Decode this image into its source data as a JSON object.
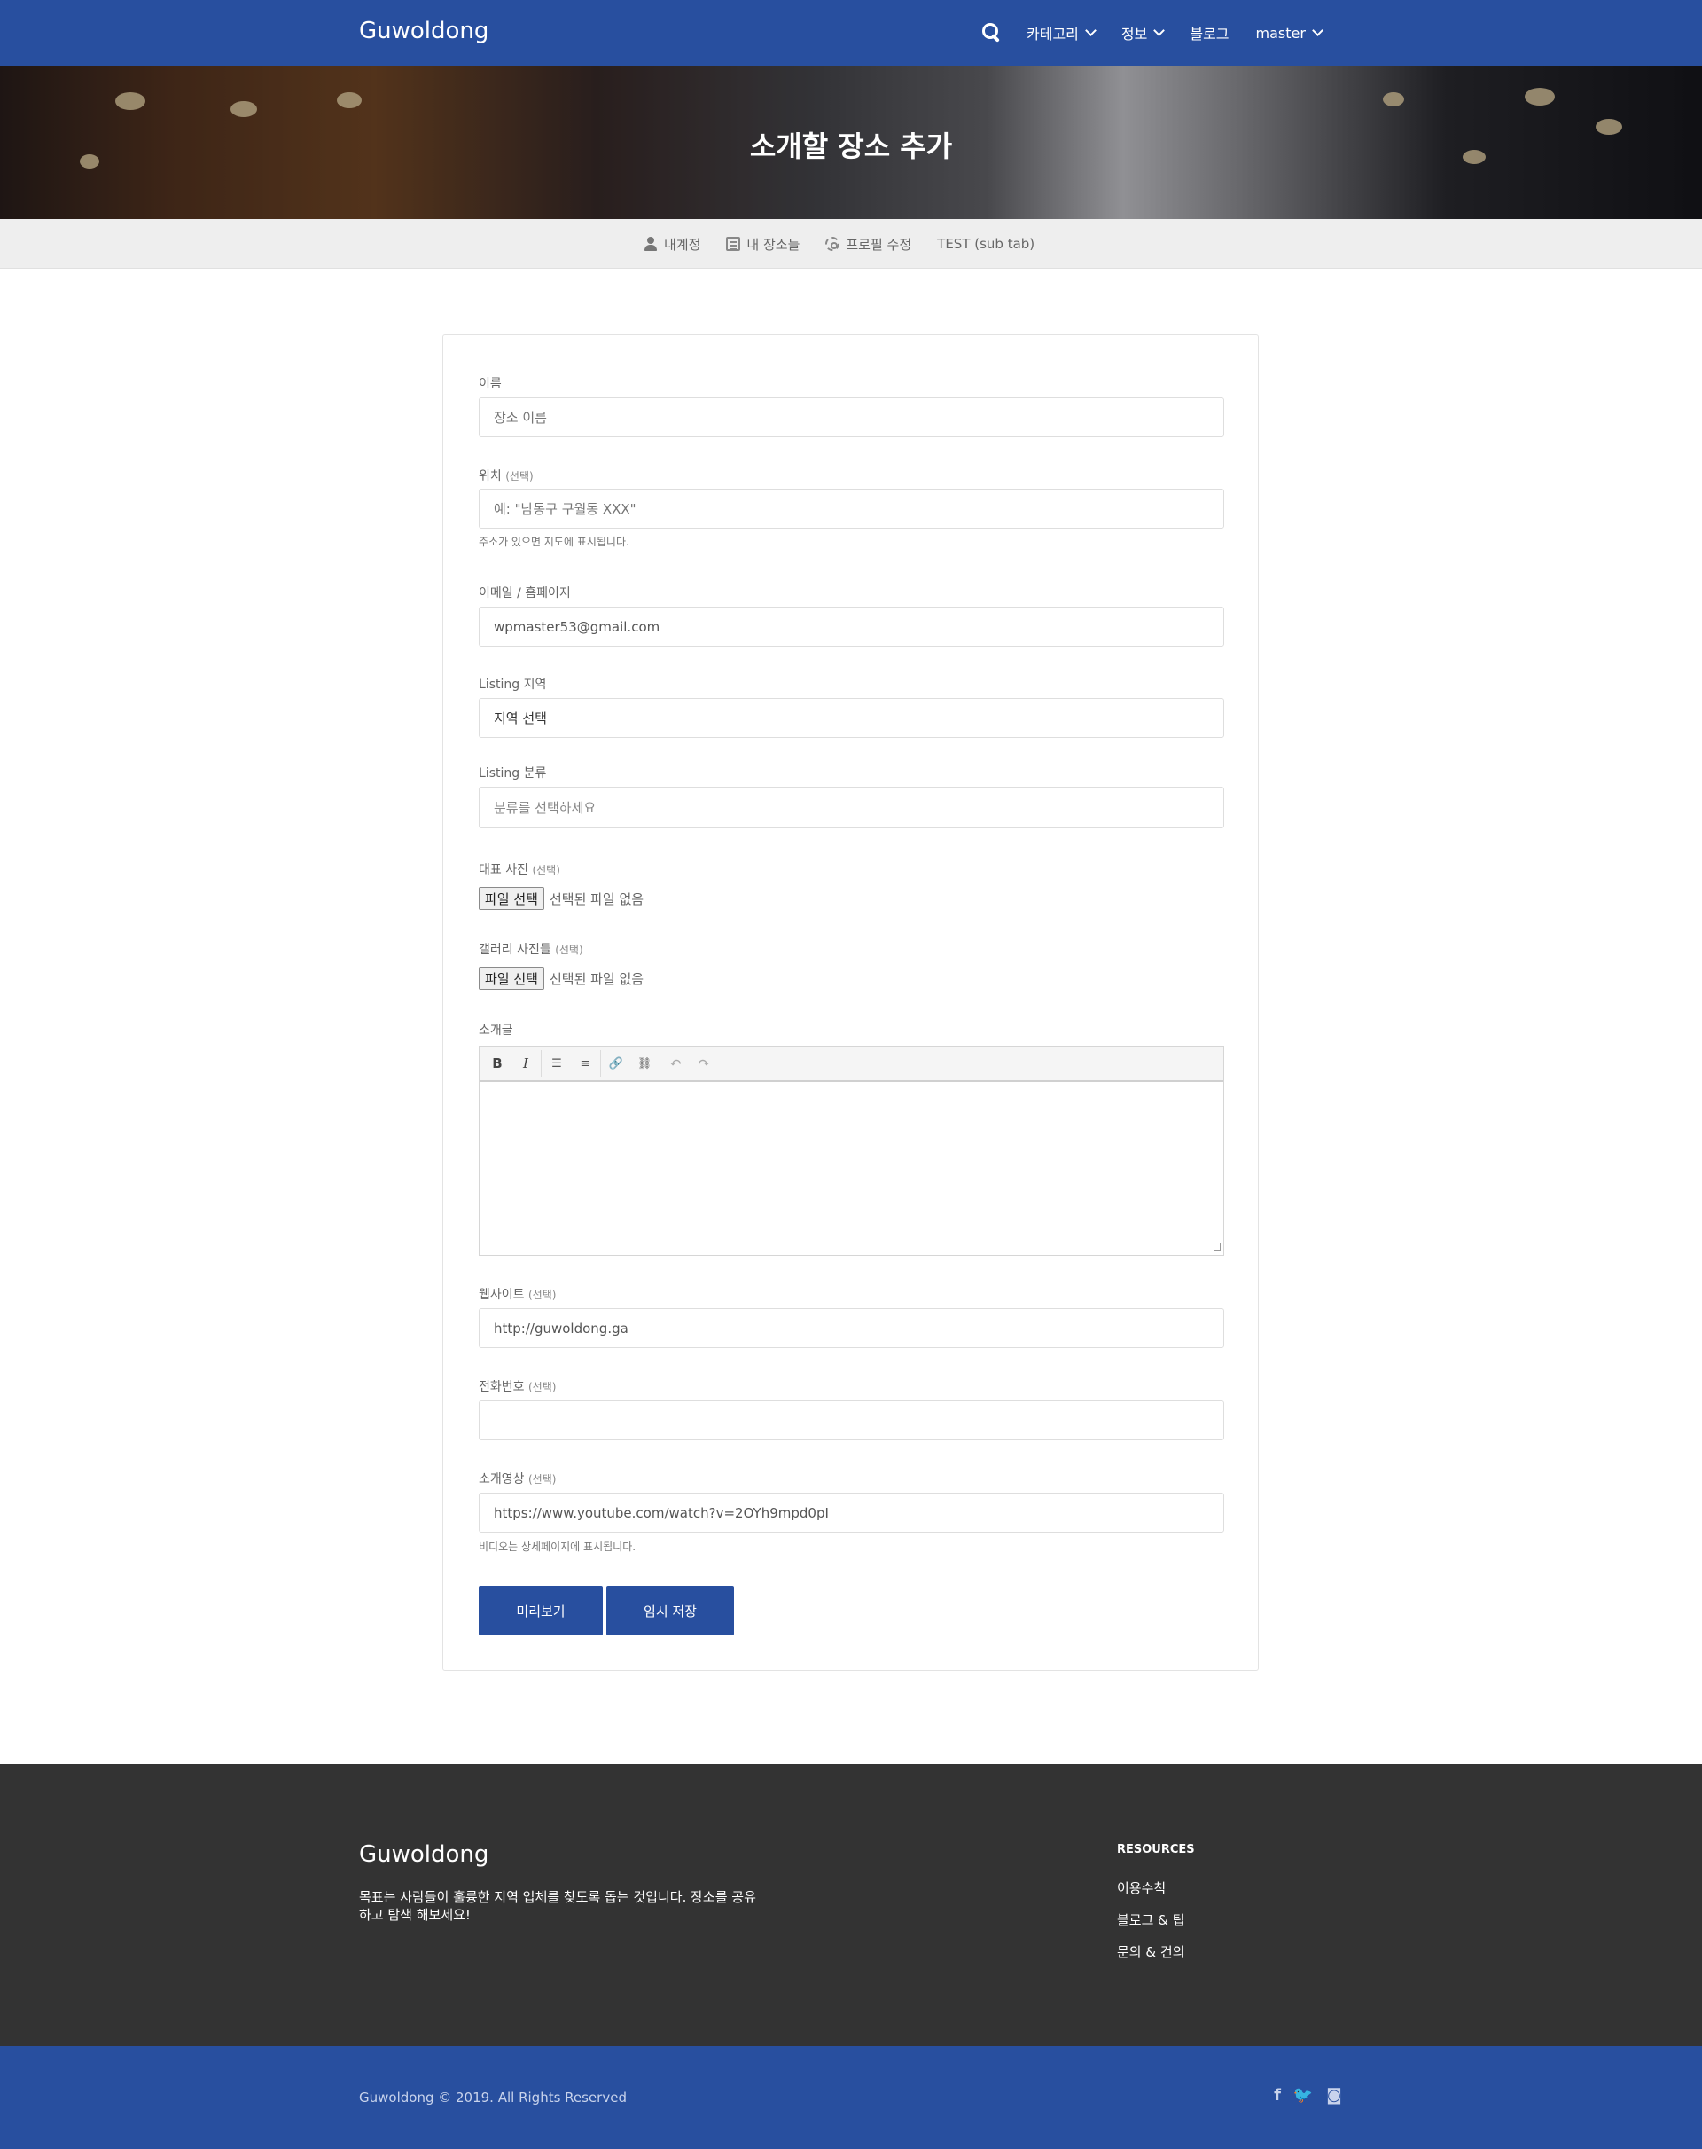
{
  "nav": {
    "brand": "Guwoldong",
    "items": [
      {
        "label": "카테고리",
        "dropdown": true
      },
      {
        "label": "정보",
        "dropdown": true
      },
      {
        "label": "블로그",
        "dropdown": false
      },
      {
        "label": "master",
        "dropdown": true
      }
    ],
    "search_icon": "search-icon"
  },
  "hero": {
    "title": "소개할 장소 추가"
  },
  "subtabs": [
    {
      "label": "내계정",
      "icon": "user-icon"
    },
    {
      "label": "내 장소들",
      "icon": "document-icon"
    },
    {
      "label": "프로필 수정",
      "icon": "gear-icon"
    },
    {
      "label": "TEST (sub tab)",
      "icon": ""
    }
  ],
  "form": {
    "name": {
      "label": "이름",
      "placeholder": "장소 이름",
      "value": ""
    },
    "location": {
      "label": "위치",
      "optional": "(선택)",
      "placeholder": "예: \"남동구 구월동 XXX\"",
      "help": "주소가 있으면 지도에 표시됩니다."
    },
    "email": {
      "label": "이메일 / 홈페이지",
      "value": "wpmaster53@gmail.com"
    },
    "region": {
      "label": "Listing 지역",
      "value": "지역 선택"
    },
    "category": {
      "label": "Listing 분류",
      "placeholder": "분류를 선택하세요"
    },
    "featured_photo": {
      "label": "대표 사진",
      "optional": "(선택)",
      "button": "파일 선택",
      "status": "선택된 파일 없음"
    },
    "gallery": {
      "label": "갤러리 사진들",
      "optional": "(선택)",
      "button": "파일 선택",
      "status": "선택된 파일 없음"
    },
    "description": {
      "label": "소개글",
      "toolbar": [
        "bold",
        "italic",
        "bullet-list",
        "numbered-list",
        "link",
        "unlink",
        "undo",
        "redo"
      ]
    },
    "website": {
      "label": "웹사이트",
      "optional": "(선택)",
      "value": "http://guwoldong.ga"
    },
    "phone": {
      "label": "전화번호",
      "optional": "(선택)",
      "value": ""
    },
    "video": {
      "label": "소개영상",
      "optional": "(선택)",
      "value": "https://www.youtube.com/watch?v=2OYh9mpd0pI",
      "help": "비디오는 상세페이지에 표시됩니다."
    },
    "buttons": {
      "preview": "미리보기",
      "save_draft": "임시 저장"
    }
  },
  "footer": {
    "brand": "Guwoldong",
    "description": "목표는 사람들이 훌륭한 지역 업체를 찾도록 돕는 것입니다. 장소를 공유하고 탐색 해보세요!",
    "resources_title": "RESOURCES",
    "links": [
      "이용수칙",
      "블로그 & 팁",
      "문의 & 건의"
    ],
    "copyright": "Guwoldong © 2019. All Rights Reserved",
    "social": [
      "facebook-icon",
      "twitter-icon",
      "instagram-icon"
    ]
  },
  "colors": {
    "brand_blue": "#284f9f",
    "footer_dark": "#333333",
    "subtab_bg": "#eeeeee"
  }
}
